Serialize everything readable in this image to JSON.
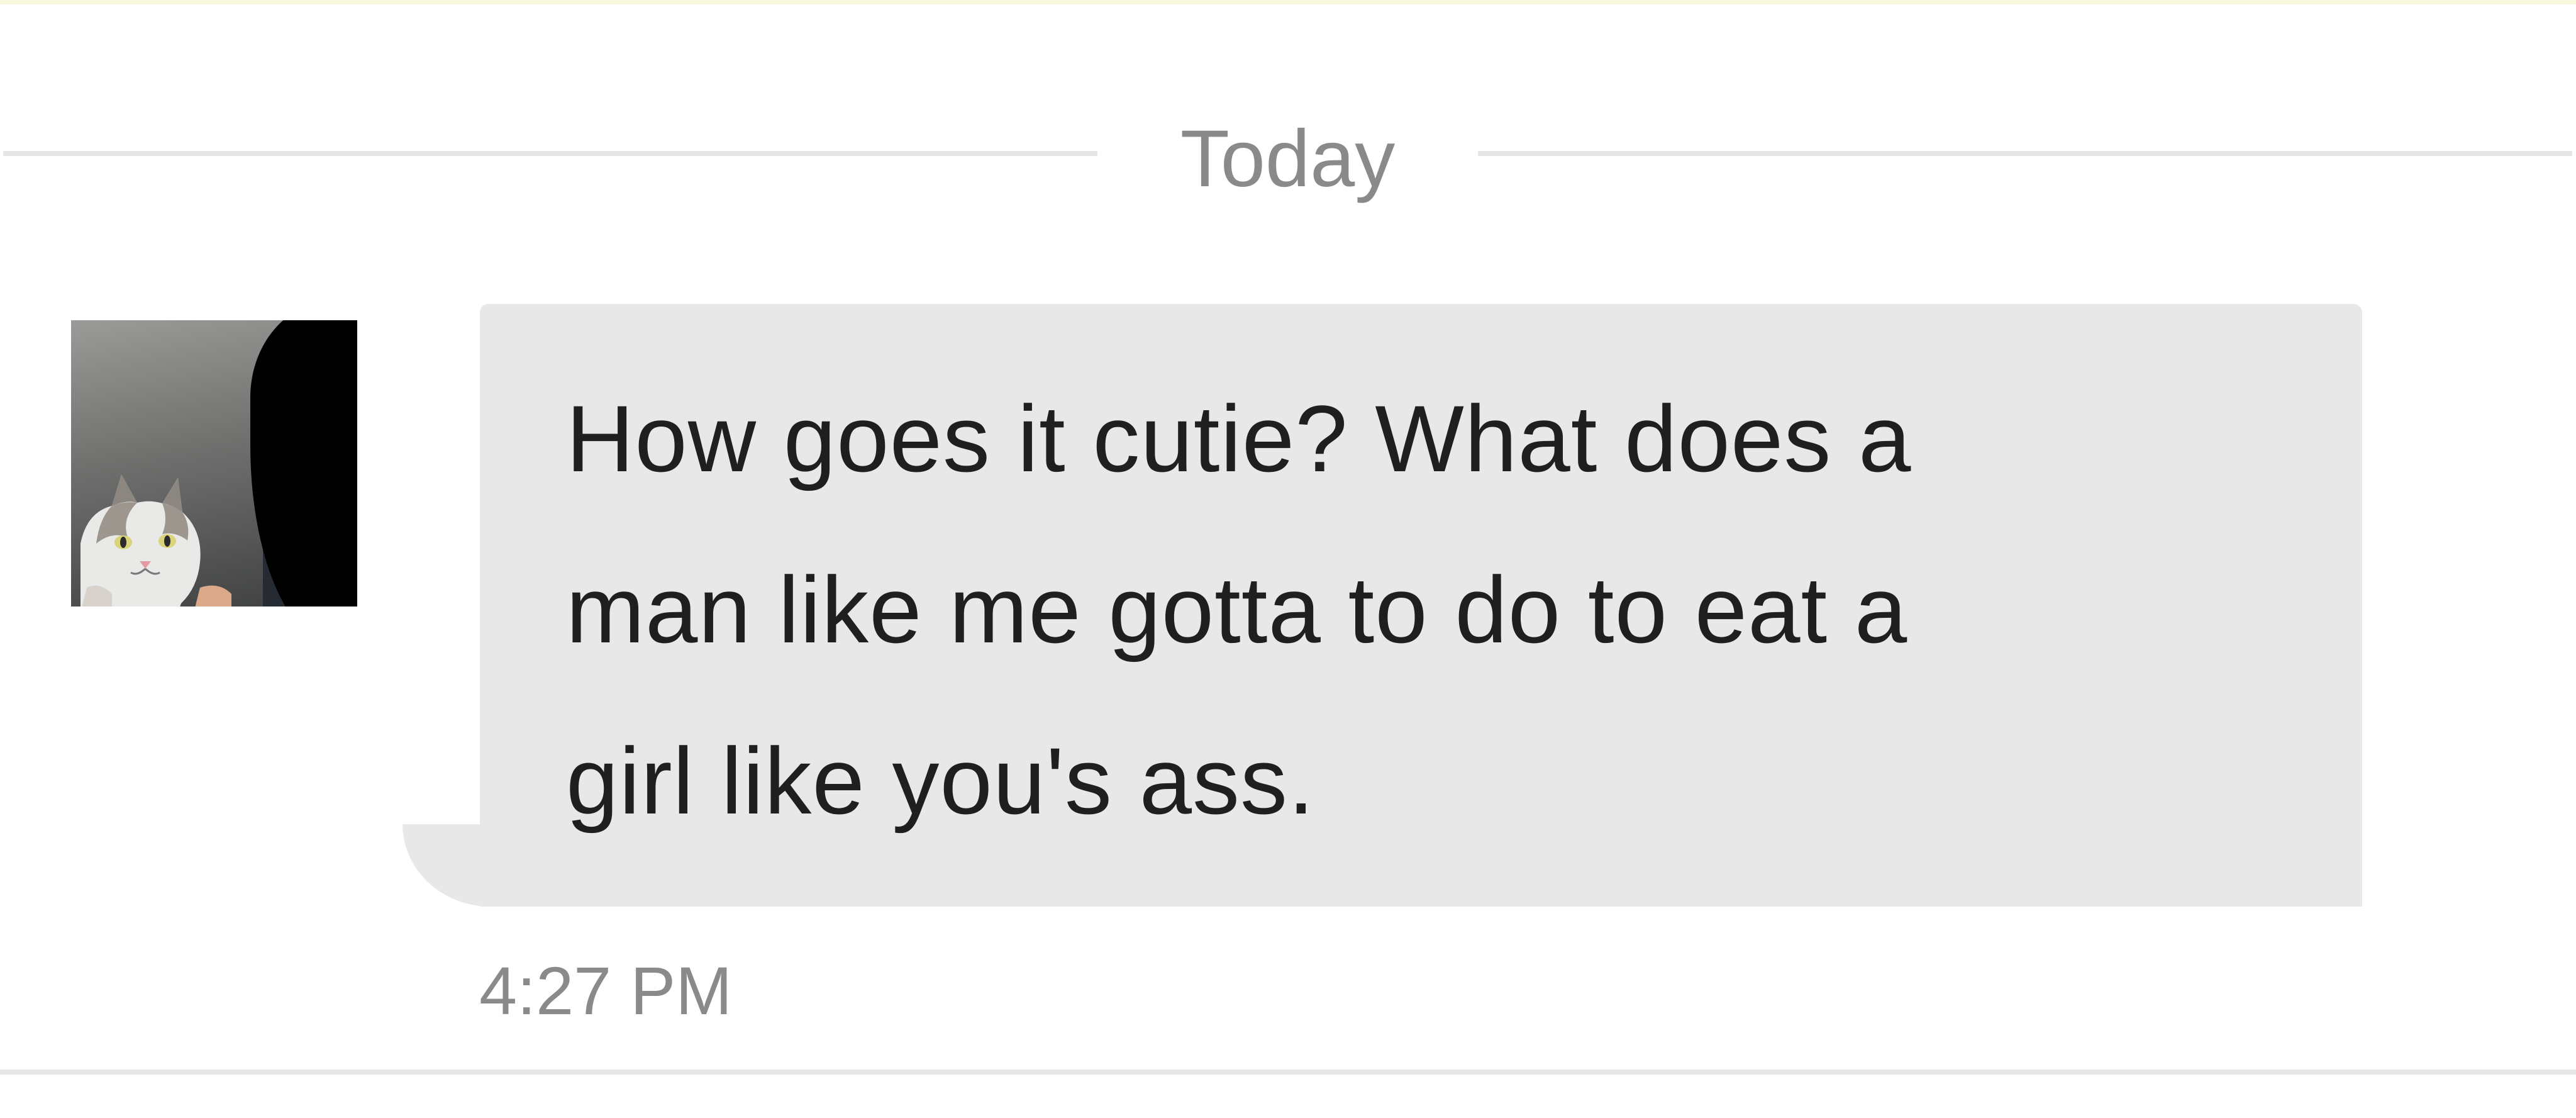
{
  "colors": {
    "background": "#ffffff",
    "bubble": "#e8e8e8",
    "message_text": "#1f1f1f",
    "muted_text": "#8a8a8a",
    "divider": "#e6e6e6",
    "top_strip": "#f8f6dc"
  },
  "conversation": {
    "date_separator": "Today",
    "messages": [
      {
        "text": "How goes it cutie? What does a\nman like me gotta to do to eat a\ngirl like you's ass.",
        "time": "4:27 PM",
        "avatar_icon": "cat-photo-avatar"
      }
    ]
  }
}
